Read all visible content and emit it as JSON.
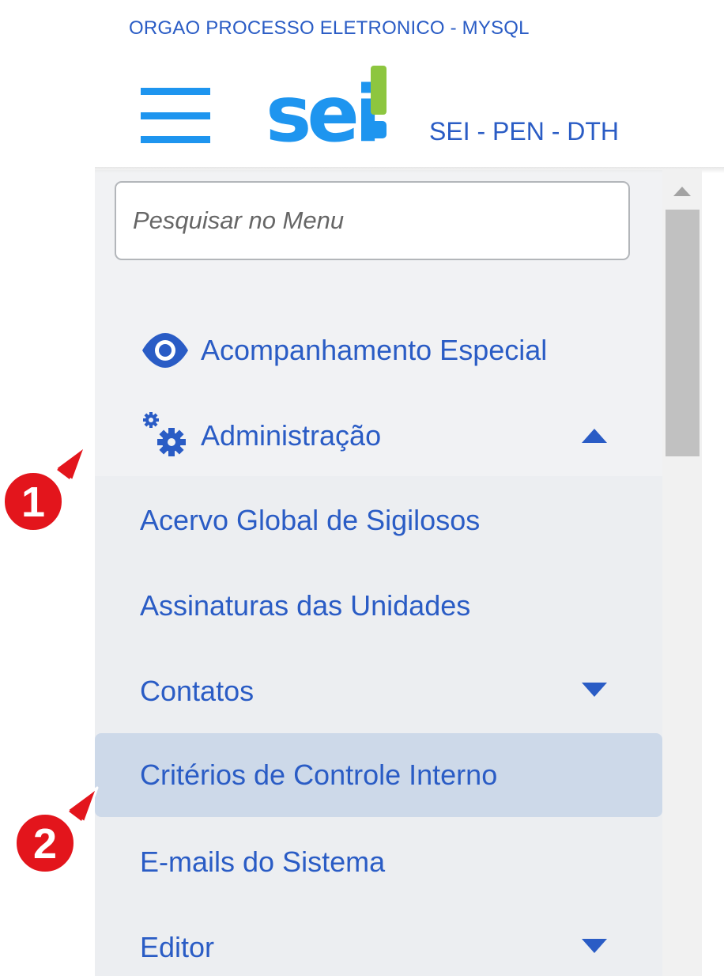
{
  "header": {
    "org_title": "ORGAO PROCESSO ELETRONICO - MYSQL",
    "logo_text": "sei!",
    "unit_label": "SEI - PEN - DTH",
    "brand_blue": "#1e95ef",
    "brand_green": "#8dc63f"
  },
  "sidebar": {
    "search_placeholder": "Pesquisar no Menu",
    "menu": [
      {
        "label": "Acompanhamento Especial",
        "icon": "eye-icon"
      },
      {
        "label": "Administração",
        "icon": "gears-icon",
        "expanded": true
      }
    ],
    "submenu": [
      {
        "label": "Acervo Global de Sigilosos"
      },
      {
        "label": "Assinaturas das Unidades"
      },
      {
        "label": "Contatos",
        "has_children": true
      },
      {
        "label": "Critérios de Controle Interno",
        "active": true
      },
      {
        "label": "E-mails do Sistema"
      },
      {
        "label": "Editor",
        "has_children": true
      }
    ]
  },
  "callouts": [
    {
      "number": "1"
    },
    {
      "number": "2"
    }
  ],
  "colors": {
    "link": "#2a5cc5",
    "sidebar_bg": "#f1f2f4",
    "active_bg": "#cdd9e9",
    "callout_red": "#e3151c"
  }
}
